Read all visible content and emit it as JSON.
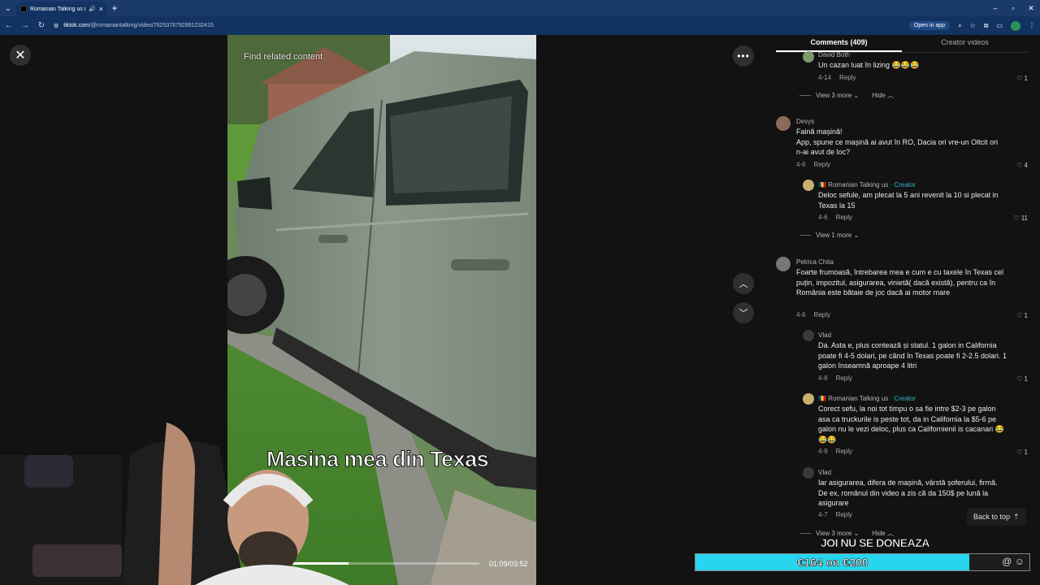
{
  "browser": {
    "tab_title": "Romanian Talking us (@...",
    "url_host": "tiktok.com",
    "url_path": "/@romaniantalking/video/7625376792861232415",
    "open_in_app": "Open in app"
  },
  "video": {
    "search_placeholder": "Find related content",
    "caption": "Masina mea din Texas",
    "time": "01:09/03:52",
    "progress_fraction": 0.3
  },
  "panel": {
    "tabs": [
      "Comments (409)",
      "Creator videos"
    ]
  },
  "comments": [
    {
      "name": "David Both",
      "text": "Un cazan luat în lizing 😂😂😂",
      "date": "4-14",
      "reply": "Reply",
      "likes": "1"
    },
    {
      "viewmore": "View 3 more",
      "hide": "Hide"
    },
    {
      "name": "Devys",
      "text": "Faină mașină!\nApp, spune ce mașină ai avut în RO, Dacia ori vre-un Oltcit ori n-ai avut de loc?",
      "date": "4-6",
      "reply": "Reply",
      "likes": "4"
    },
    {
      "name": "🇷🇴 Romanian Talking us",
      "creator": " · Creator",
      "text": "Deloc sefule, am plecat la 5 ani revenit la 10 si plecat in Texas la 15",
      "date": "4-6",
      "reply": "Reply",
      "likes": "11"
    },
    {
      "viewmore": "View 1 more"
    },
    {
      "name": "Petrica Chita",
      "text": "Foarte frumoasă, întrebarea mea e cum e cu taxele în Texas cel puțin, impozitul, asigurarea, vinietă( dacă există), pentru ca în România este bătaie de joc dacă ai motor mare",
      "date": "4-6",
      "reply": "Reply",
      "likes": "1"
    },
    {
      "name": "Vlad",
      "text": "Da. Asta e, plus contează și statul. 1 galon in California poate fi 4-5 dolari, pe când în Texas poate fi 2-2.5 dolari. 1 galon înseamnă aproape 4 litri",
      "date": "4-8",
      "reply": "Reply",
      "likes": "1"
    },
    {
      "name": "🇷🇴 Romanian Talking us",
      "creator": " · Creator",
      "text": "Corect sefu, la noi tot timpu o sa fie intre $2-3 pe galon asa ca truckurile is peste tot, da in California la $5-6 pe galon nu le vezi deloc, plus ca Californienii is cacanari 😂😂😂",
      "date": "4-9",
      "reply": "Reply",
      "likes": "1"
    },
    {
      "name": "Vlad",
      "text": "Iar asigurarea, difera de mașină, vârstă șoferului, firmă. De ex, românul din video a zis că da 150$ pe lună la asigurare",
      "date": "4-7",
      "reply": "Reply",
      "likes": ""
    },
    {
      "viewmore": "View 3 more",
      "hide": "Hide"
    }
  ],
  "back_to_top": "Back to top",
  "overlay": {
    "donate_title": "JOI NU SE DONEAZA",
    "donate_label": "€164 on €200",
    "donate_fraction": 0.82
  }
}
